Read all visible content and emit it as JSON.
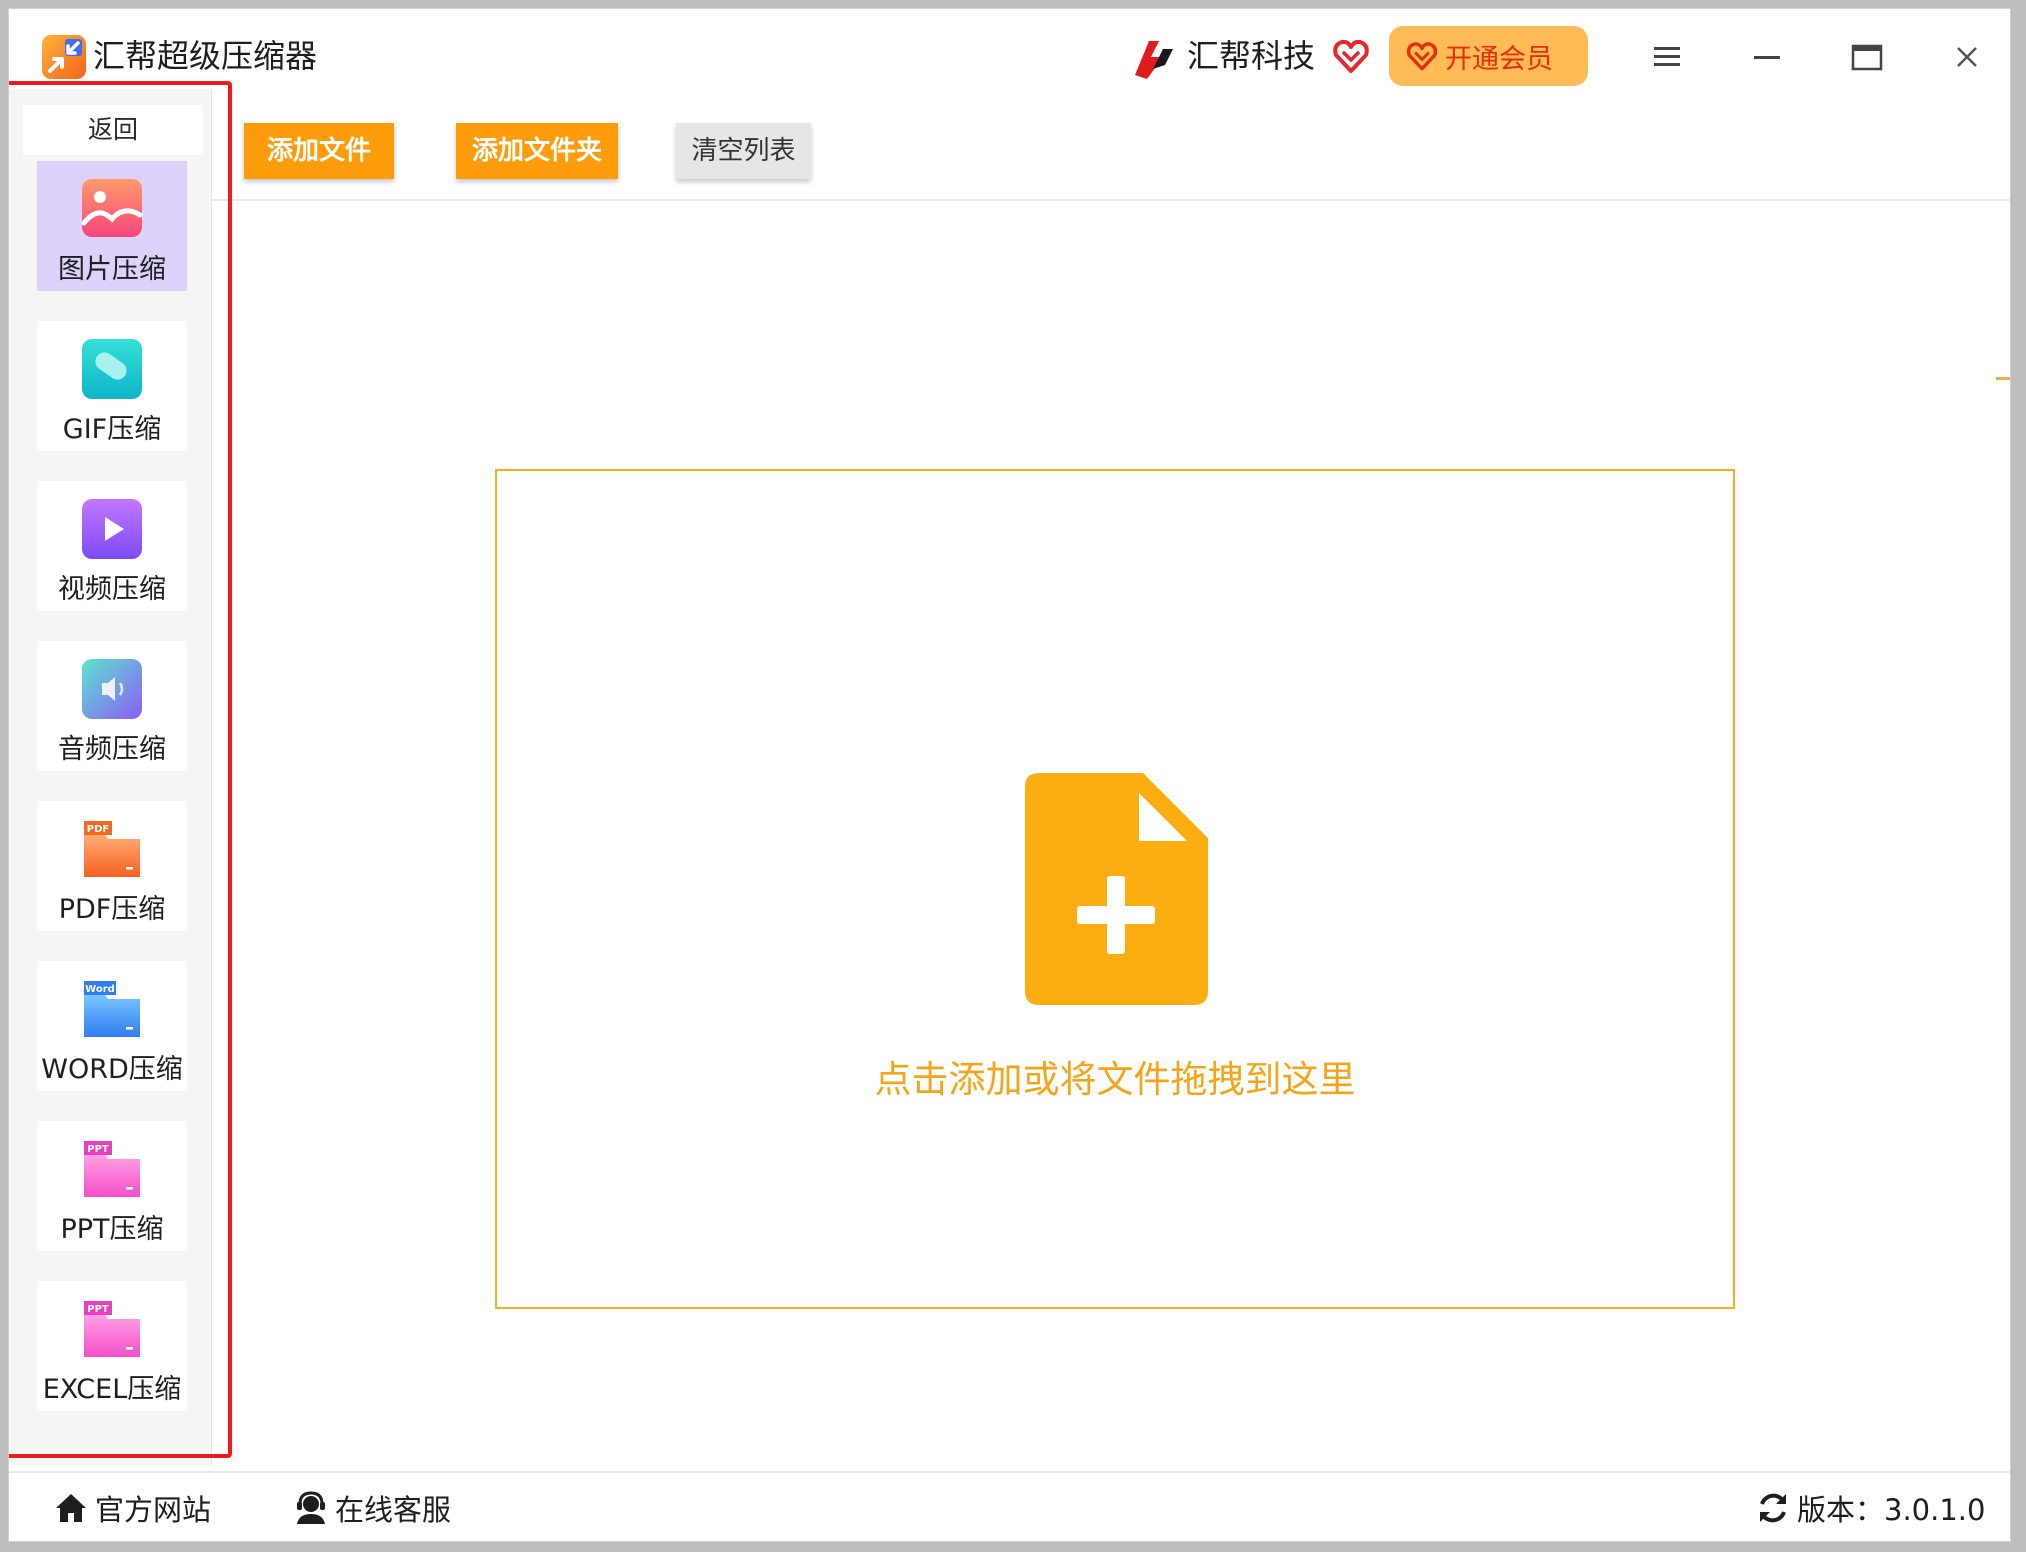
{
  "app": {
    "title": "汇帮超级压缩器",
    "brand_name": "汇帮科技",
    "vip_label": "开通会员"
  },
  "icons": {
    "app_logo": "compress-arrows-icon",
    "brand_logo": "huibang-logo-icon",
    "brand_heart": "vip-heart-icon",
    "menu": "hamburger-menu-icon",
    "minimize": "minimize-icon",
    "maximize": "maximize-icon",
    "close": "close-icon",
    "home": "home-icon",
    "service": "customer-service-icon",
    "refresh": "refresh-icon",
    "file_add": "file-add-icon"
  },
  "sidebar": {
    "back_label": "返回",
    "items": [
      {
        "label": "图片压缩",
        "icon": "image-compress-icon",
        "active": true
      },
      {
        "label": "GIF压缩",
        "icon": "gif-compress-icon",
        "active": false
      },
      {
        "label": "视频压缩",
        "icon": "video-compress-icon",
        "active": false
      },
      {
        "label": "音频压缩",
        "icon": "audio-compress-icon",
        "active": false
      },
      {
        "label": "PDF压缩",
        "icon": "pdf-compress-icon",
        "active": false
      },
      {
        "label": "WORD压缩",
        "icon": "word-compress-icon",
        "active": false
      },
      {
        "label": "PPT压缩",
        "icon": "ppt-compress-icon",
        "active": false
      },
      {
        "label": "EXCEL压缩",
        "icon": "excel-compress-icon",
        "active": false
      }
    ],
    "icon_tags": {
      "pdf": "PDF",
      "word": "Word",
      "ppt": "PPT",
      "excel": "PPT"
    }
  },
  "toolbar": {
    "add_file": "添加文件",
    "add_folder": "添加文件夹",
    "clear_list": "清空列表"
  },
  "dropzone": {
    "text": "点击添加或将文件拖拽到这里"
  },
  "status": {
    "website": "官方网站",
    "service": "在线客服",
    "version": "版本：3.0.1.0"
  },
  "colors": {
    "accent_orange": "#fe9c0b",
    "dropzone_border": "#fcad1e",
    "vip_bg": "#ffbb55",
    "vip_text": "#e62e0f",
    "highlight_red": "#ee1c1c",
    "active_nav_bg": "#dcd2fb"
  }
}
